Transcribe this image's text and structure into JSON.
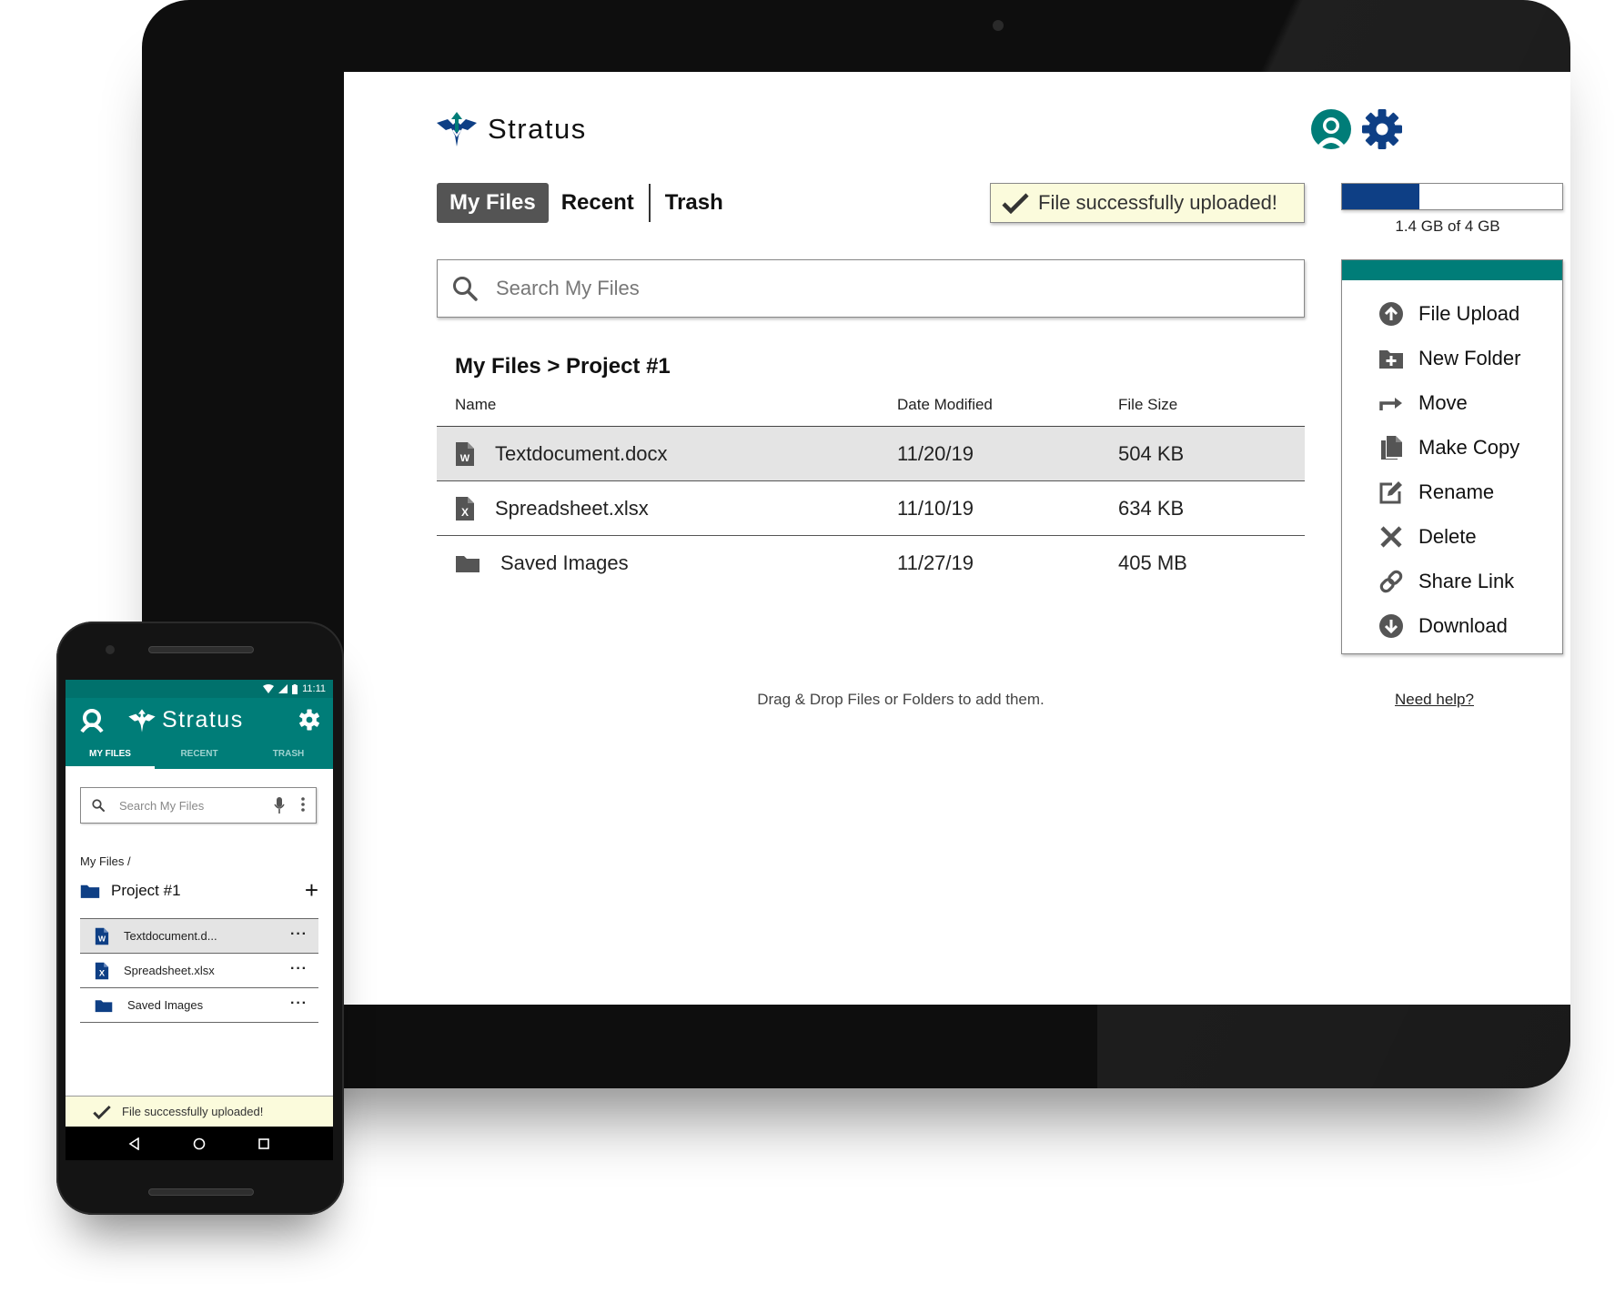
{
  "app": {
    "name": "Stratus"
  },
  "colors": {
    "accent_teal": "#007d78",
    "brand_blue": "#0e3f85",
    "toast_bg": "#fbfbdc",
    "tab_active_bg": "#545454"
  },
  "desktop": {
    "tabs": [
      {
        "label": "My Files",
        "active": true
      },
      {
        "label": "Recent",
        "active": false
      },
      {
        "label": "Trash",
        "active": false
      }
    ],
    "toast": "File successfully uploaded!",
    "storage": {
      "used_fraction": 0.35,
      "label": "1.4 GB of 4 GB"
    },
    "search": {
      "placeholder": "Search My Files"
    },
    "breadcrumb": "My Files > Project #1",
    "table": {
      "headers": [
        "Name",
        "Date Modified",
        "File Size"
      ],
      "rows": [
        {
          "name": "Textdocument.docx",
          "date": "11/20/19",
          "size": "504 KB",
          "icon": "word-file-icon",
          "selected": true
        },
        {
          "name": "Spreadsheet.xlsx",
          "date": "11/10/19",
          "size": "634 KB",
          "icon": "excel-file-icon",
          "selected": false
        },
        {
          "name": "Saved Images",
          "date": "11/27/19",
          "size": "405 MB",
          "icon": "folder-icon",
          "selected": false
        }
      ]
    },
    "actions": [
      {
        "label": "File Upload",
        "icon": "upload-icon"
      },
      {
        "label": "New Folder",
        "icon": "new-folder-icon"
      },
      {
        "label": "Move",
        "icon": "move-arrow-icon"
      },
      {
        "label": "Make Copy",
        "icon": "copy-icon"
      },
      {
        "label": "Rename",
        "icon": "edit-icon"
      },
      {
        "label": "Delete",
        "icon": "close-icon"
      },
      {
        "label": "Share Link",
        "icon": "link-icon"
      },
      {
        "label": "Download",
        "icon": "download-icon"
      }
    ],
    "drop_note": "Drag & Drop Files or Folders to add them.",
    "help_link": "Need help?"
  },
  "mobile": {
    "status_time": "11:11",
    "tabs": [
      {
        "label": "MY FILES",
        "active": true
      },
      {
        "label": "RECENT",
        "active": false
      },
      {
        "label": "TRASH",
        "active": false
      }
    ],
    "search_placeholder": "Search My Files",
    "breadcrumb": "My Files /",
    "folder": "Project #1",
    "add_symbol": "+",
    "more_symbol": "···",
    "rows": [
      {
        "name": "Textdocument.d...",
        "icon": "word-file-icon",
        "selected": true
      },
      {
        "name": "Spreadsheet.xlsx",
        "icon": "excel-file-icon",
        "selected": false
      },
      {
        "name": "Saved Images",
        "icon": "folder-icon",
        "selected": false
      }
    ],
    "toast": "File successfully uploaded!"
  }
}
